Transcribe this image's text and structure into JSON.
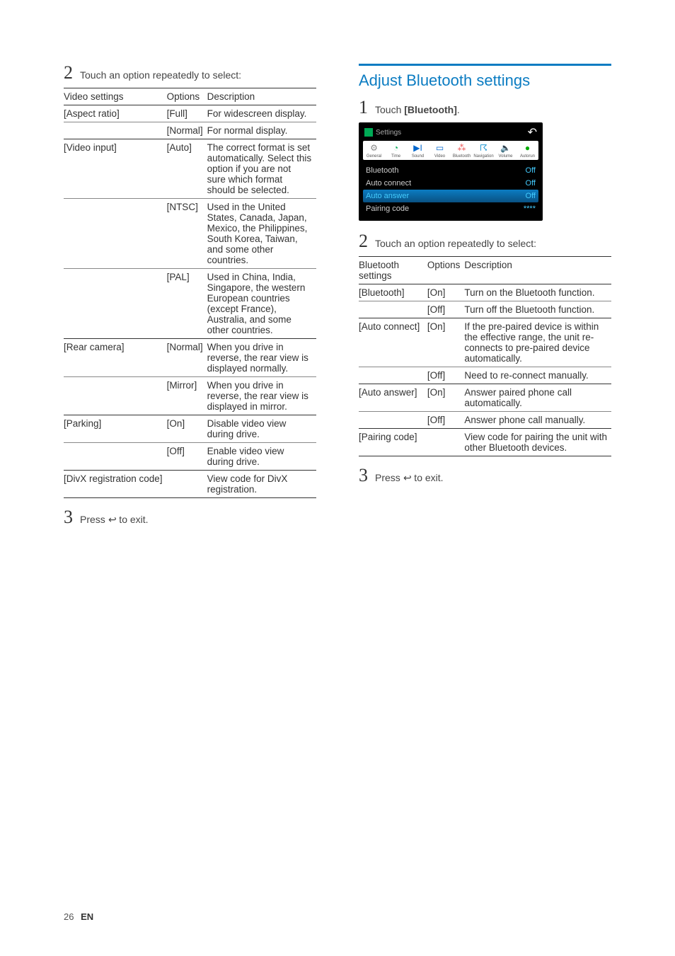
{
  "left": {
    "step2": {
      "num": "2",
      "text": "Touch an option repeatedly to select:"
    },
    "step3_prefix": {
      "num": "3",
      "lead": "Press ",
      "tail": " to exit."
    },
    "table": {
      "headers": [
        "Video settings",
        "Options",
        "Description"
      ],
      "groups": [
        {
          "setting": "[Aspect ratio]",
          "rows": [
            {
              "option": "[Full]",
              "desc": "For widescreen display."
            },
            {
              "option": "[Normal]",
              "desc": "For normal display."
            }
          ]
        },
        {
          "setting": "[Video input]",
          "rows": [
            {
              "option": "[Auto]",
              "desc": "The correct format is set automatically. Select this option if you are not sure which format should be selected."
            },
            {
              "option": "[NTSC]",
              "desc": "Used in the United States, Canada, Japan, Mexico, the Philippines, South Korea, Taiwan, and some other countries."
            },
            {
              "option": "[PAL]",
              "desc": "Used in China, India, Singapore, the western European countries (except France), Australia, and some other countries."
            }
          ]
        },
        {
          "setting": "[Rear camera]",
          "rows": [
            {
              "option": "[Normal]",
              "desc": "When you drive in reverse, the rear view is displayed normally."
            },
            {
              "option": "[Mirror]",
              "desc": "When you drive in reverse, the rear view is displayed in mirror."
            }
          ]
        },
        {
          "setting": "[Parking]",
          "rows": [
            {
              "option": "[On]",
              "desc": "Disable video view during drive."
            },
            {
              "option": "[Off]",
              "desc": "Enable video view during drive."
            }
          ]
        },
        {
          "setting": "[DivX registration code]",
          "rows": [
            {
              "option": "",
              "desc": "View code for DivX registration."
            }
          ]
        }
      ]
    }
  },
  "right": {
    "section_title": "Adjust Bluetooth settings",
    "step1": {
      "num": "1",
      "lead": "Touch ",
      "bold": "[Bluetooth]",
      "tail": "."
    },
    "step2": {
      "num": "2",
      "text": "Touch an option repeatedly to select:"
    },
    "step3_prefix": {
      "num": "3",
      "lead": "Press ",
      "tail": " to exit."
    },
    "screenshot": {
      "title": "Settings",
      "tabs": [
        {
          "icon": "gear",
          "name": "General"
        },
        {
          "icon": "clock",
          "name": "Time"
        },
        {
          "icon": "sound",
          "name": "Sound"
        },
        {
          "icon": "video",
          "name": "Video"
        },
        {
          "icon": "bt",
          "name": "Bluetooth"
        },
        {
          "icon": "nav",
          "name": "Navigation"
        },
        {
          "icon": "vol",
          "name": "Volume"
        },
        {
          "icon": "warn",
          "name": "Autorun"
        }
      ],
      "rows": [
        {
          "label": "Bluetooth",
          "value": "Off"
        },
        {
          "label": "Auto connect",
          "value": "Off"
        },
        {
          "label": "Auto answer",
          "value": "Off",
          "highlight": true
        },
        {
          "label": "Pairing code",
          "value": "****"
        }
      ]
    },
    "table": {
      "headers": [
        "Bluetooth settings",
        "Options",
        "Description"
      ],
      "groups": [
        {
          "setting": "[Bluetooth]",
          "rows": [
            {
              "option": "[On]",
              "desc": "Turn on the Bluetooth function."
            },
            {
              "option": "[Off]",
              "desc": "Turn off the Bluetooth function."
            }
          ]
        },
        {
          "setting": "[Auto connect]",
          "rows": [
            {
              "option": "[On]",
              "desc": "If the pre-paired device is within the effective range, the unit re-connects to pre-paired device automatically."
            },
            {
              "option": "[Off]",
              "desc": "Need to re-connect manually."
            }
          ]
        },
        {
          "setting": "[Auto answer]",
          "rows": [
            {
              "option": "[On]",
              "desc": "Answer paired phone call automatically."
            },
            {
              "option": "[Off]",
              "desc": "Answer phone call manually."
            }
          ]
        },
        {
          "setting": "[Pairing code]",
          "rows": [
            {
              "option": "",
              "desc": "View code for pairing the unit with other Bluetooth devices."
            }
          ]
        }
      ]
    }
  },
  "footer": {
    "page": "26",
    "lang": "EN"
  }
}
